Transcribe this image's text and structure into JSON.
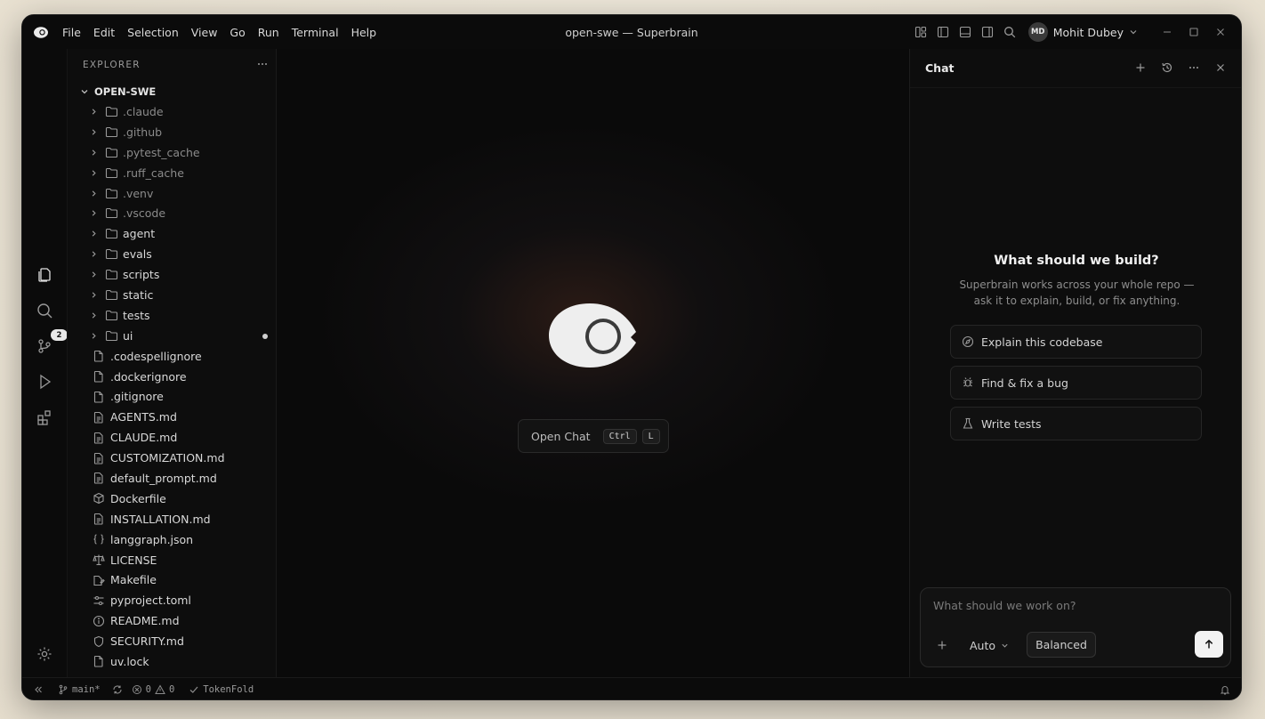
{
  "window": {
    "title": "open-swe — Superbrain"
  },
  "menu": [
    "File",
    "Edit",
    "Selection",
    "View",
    "Go",
    "Run",
    "Terminal",
    "Help"
  ],
  "user": {
    "initials": "MD",
    "name": "Mohit Dubey"
  },
  "activity": {
    "source_control_badge": "2"
  },
  "explorer": {
    "title": "EXPLORER",
    "root": "OPEN-SWE",
    "folders": [
      {
        "name": ".claude",
        "dim": true
      },
      {
        "name": ".github",
        "dim": true
      },
      {
        "name": ".pytest_cache",
        "dim": true
      },
      {
        "name": ".ruff_cache",
        "dim": true
      },
      {
        "name": ".venv",
        "dim": true
      },
      {
        "name": ".vscode",
        "dim": true
      },
      {
        "name": "agent",
        "dim": false
      },
      {
        "name": "evals",
        "dim": false
      },
      {
        "name": "scripts",
        "dim": false
      },
      {
        "name": "static",
        "dim": false
      },
      {
        "name": "tests",
        "dim": false
      },
      {
        "name": "ui",
        "dim": false,
        "modified": true
      }
    ],
    "files": [
      {
        "name": ".codespellignore",
        "icon": "file"
      },
      {
        "name": ".dockerignore",
        "icon": "file"
      },
      {
        "name": ".gitignore",
        "icon": "file"
      },
      {
        "name": "AGENTS.md",
        "icon": "doc"
      },
      {
        "name": "CLAUDE.md",
        "icon": "doc"
      },
      {
        "name": "CUSTOMIZATION.md",
        "icon": "doc"
      },
      {
        "name": "default_prompt.md",
        "icon": "doc"
      },
      {
        "name": "Dockerfile",
        "icon": "box"
      },
      {
        "name": "INSTALLATION.md",
        "icon": "doc"
      },
      {
        "name": "langgraph.json",
        "icon": "braces"
      },
      {
        "name": "LICENSE",
        "icon": "scale"
      },
      {
        "name": "Makefile",
        "icon": "make"
      },
      {
        "name": "pyproject.toml",
        "icon": "settings"
      },
      {
        "name": "README.md",
        "icon": "info"
      },
      {
        "name": "SECURITY.md",
        "icon": "shield"
      },
      {
        "name": "uv.lock",
        "icon": "file"
      }
    ]
  },
  "editor": {
    "open_chat_label": "Open Chat",
    "shortcut_mod": "Ctrl",
    "shortcut_key": "L"
  },
  "chat": {
    "title": "Chat",
    "hero_title": "What should we build?",
    "hero_subtitle": "Superbrain works across your whole repo — ask it to explain, build, or fix anything.",
    "suggestions": [
      {
        "label": "Explain this codebase",
        "icon": "compass-icon"
      },
      {
        "label": "Find & fix a bug",
        "icon": "bug-icon"
      },
      {
        "label": "Write tests",
        "icon": "flask-icon"
      }
    ],
    "composer": {
      "placeholder": "What should we work on?",
      "mode": "Auto",
      "effort": "Balanced"
    }
  },
  "status": {
    "branch": "main*",
    "errors": "0",
    "warnings": "0",
    "extension": "TokenFold"
  }
}
